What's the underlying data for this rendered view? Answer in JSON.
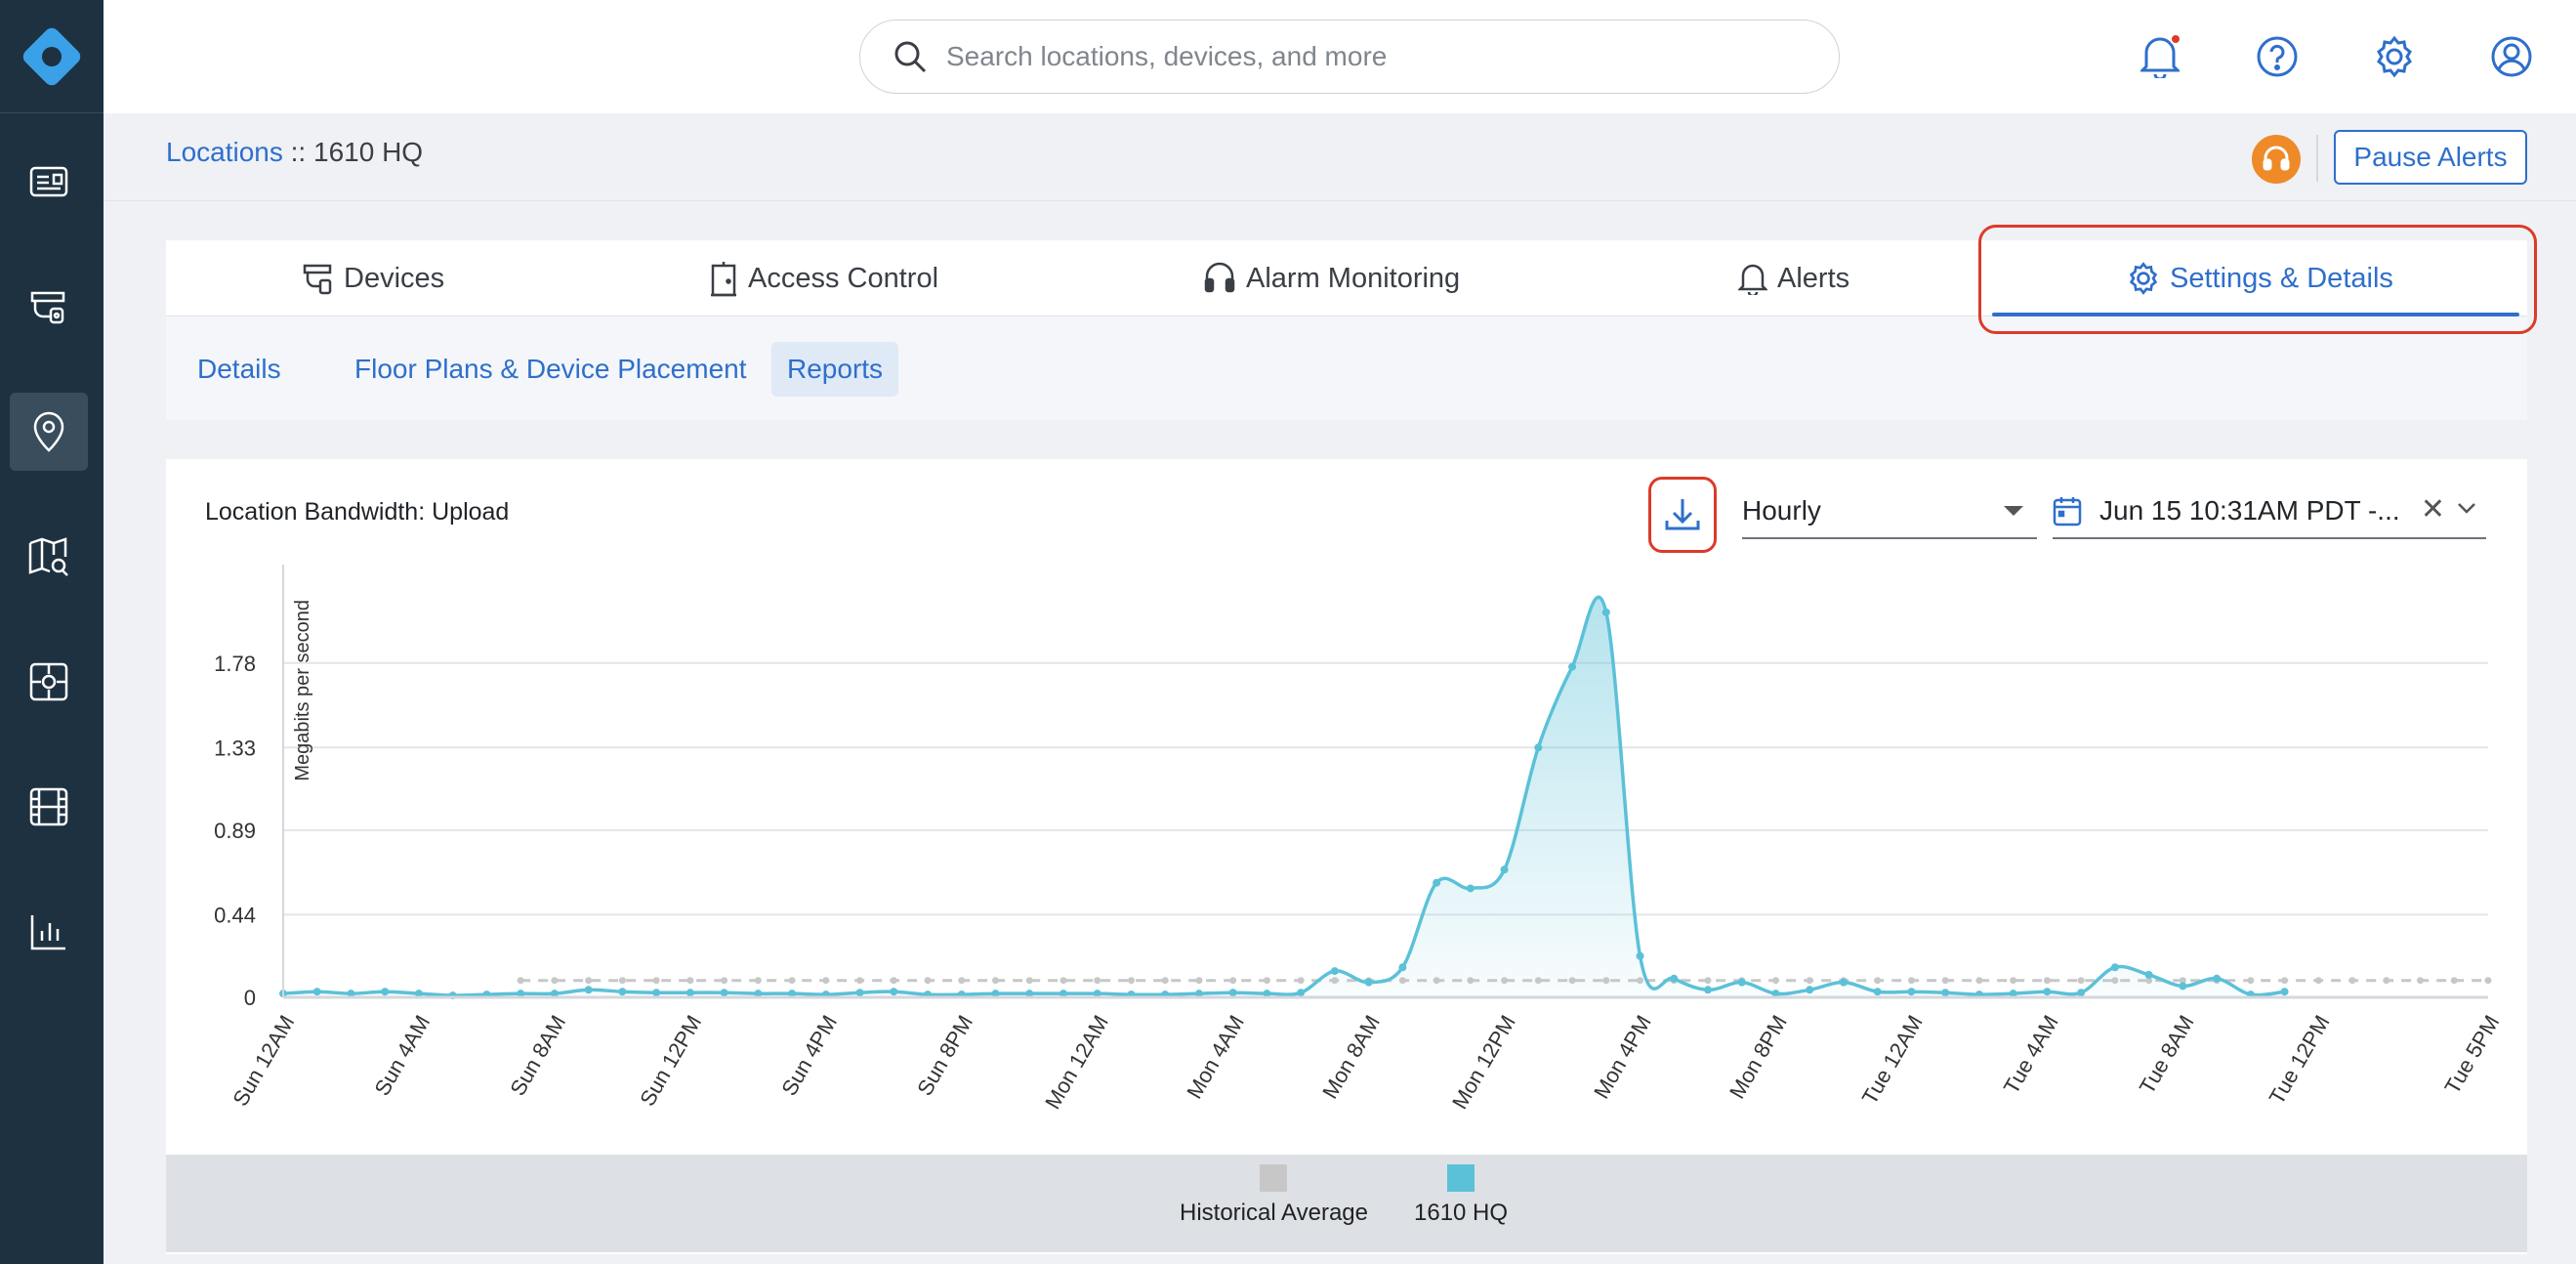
{
  "sidebar": {
    "items": [
      {
        "name": "dashboard",
        "icon": "dashboard-card-icon"
      },
      {
        "name": "cameras",
        "icon": "camera-icon"
      },
      {
        "name": "locations",
        "icon": "location-pin-icon",
        "active": true
      },
      {
        "name": "map-search",
        "icon": "map-search-icon"
      },
      {
        "name": "access",
        "icon": "access-panel-icon"
      },
      {
        "name": "video",
        "icon": "film-icon"
      },
      {
        "name": "reports",
        "icon": "bar-chart-icon"
      }
    ]
  },
  "search": {
    "placeholder": "Search locations, devices, and more"
  },
  "breadcrumb": {
    "link": "Locations",
    "separator": " :: ",
    "current": "1610 HQ"
  },
  "header": {
    "pause_label": "Pause Alerts"
  },
  "tabs": [
    {
      "label": "Devices",
      "icon": "devices-icon"
    },
    {
      "label": "Access Control",
      "icon": "door-icon"
    },
    {
      "label": "Alarm Monitoring",
      "icon": "headset-icon"
    },
    {
      "label": "Alerts",
      "icon": "bell-icon"
    },
    {
      "label": "Settings & Details",
      "icon": "gear-icon",
      "active": true
    }
  ],
  "subtabs": [
    {
      "label": "Details"
    },
    {
      "label": "Floor Plans & Device Placement"
    },
    {
      "label": "Reports",
      "active": true
    }
  ],
  "chart_panel": {
    "title": "Location Bandwidth: Upload",
    "interval": "Hourly",
    "date_range": "Jun 15 10:31AM PDT -..."
  },
  "colors": {
    "accent": "#2e6fcb",
    "series": "#5bc1d8",
    "historical": "#c7c7c7",
    "sidebar": "#1d3140",
    "highlight": "#dc3a2a"
  },
  "chart_data": {
    "type": "area",
    "ylabel": "Megabits per second",
    "ylim": [
      0,
      2.2
    ],
    "y_ticks": [
      "0",
      "0.44",
      "0.89",
      "1.33",
      "1.78"
    ],
    "y_tick_values": [
      0,
      0.44,
      0.89,
      1.33,
      1.78
    ],
    "x_ticks": [
      "Sun 12AM",
      "Sun 4AM",
      "Sun 8AM",
      "Sun 12PM",
      "Sun 4PM",
      "Sun 8PM",
      "Mon 12AM",
      "Mon 4AM",
      "Mon 8AM",
      "Mon 12PM",
      "Mon 4PM",
      "Mon 8PM",
      "Tue 12AM",
      "Tue 4AM",
      "Tue 8AM",
      "Tue 12PM",
      "Tue 5PM"
    ],
    "x_tick_hours": [
      0,
      4,
      8,
      12,
      16,
      20,
      24,
      28,
      32,
      36,
      40,
      44,
      48,
      52,
      56,
      60,
      65
    ],
    "grid": true,
    "legend": "bottom",
    "series": [
      {
        "name": "Historical Average",
        "x_start_hour": 7,
        "x_end_hour": 65,
        "value": 0.09
      },
      {
        "name": "1610 HQ",
        "values": [
          0.02,
          0.03,
          0.02,
          0.03,
          0.02,
          0.01,
          0.015,
          0.02,
          0.02,
          0.04,
          0.03,
          0.025,
          0.025,
          0.025,
          0.02,
          0.02,
          0.015,
          0.025,
          0.03,
          0.015,
          0.015,
          0.02,
          0.02,
          0.02,
          0.02,
          0.015,
          0.015,
          0.02,
          0.025,
          0.02,
          0.025,
          0.14,
          0.08,
          0.16,
          0.61,
          0.58,
          0.68,
          1.33,
          1.76,
          2.05,
          0.22,
          0.1,
          0.04,
          0.08,
          0.02,
          0.04,
          0.08,
          0.03,
          0.03,
          0.025,
          0.015,
          0.02,
          0.03,
          0.025,
          0.16,
          0.12,
          0.06,
          0.1,
          0.015,
          0.03
        ]
      }
    ]
  }
}
